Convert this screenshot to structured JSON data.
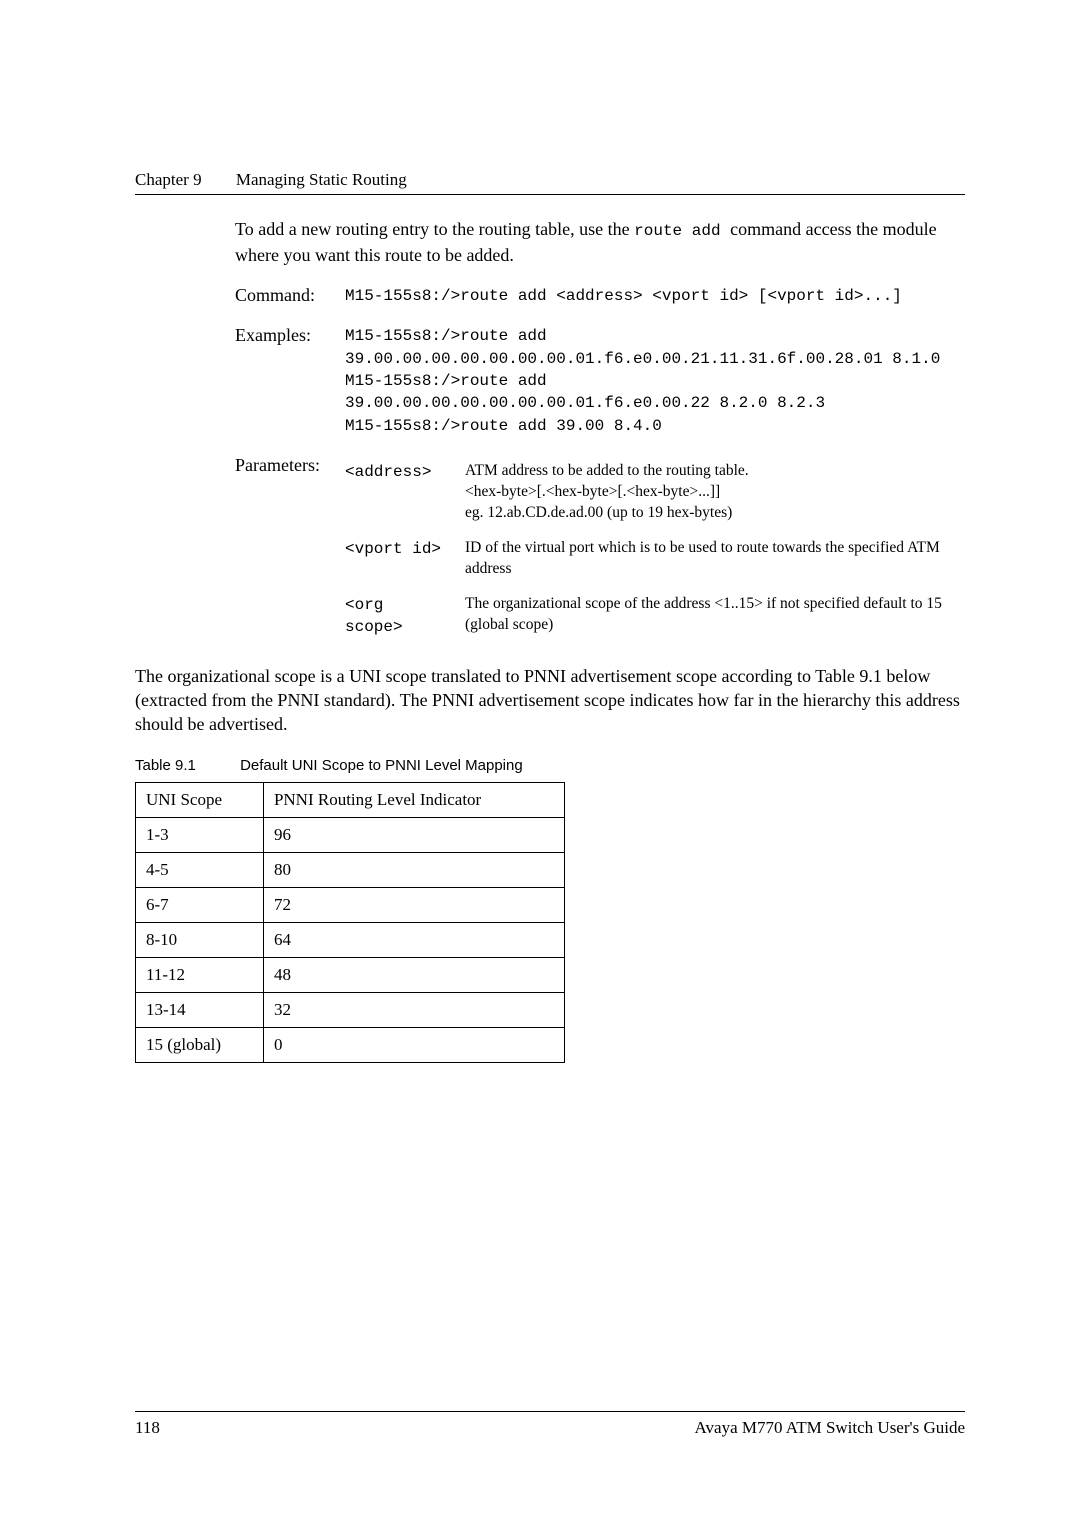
{
  "header": {
    "chapter_label": "Chapter 9",
    "chapter_title": "Managing Static Routing"
  },
  "intro": {
    "text_a": "To add a new routing entry to the routing table, use the ",
    "code": " route add ",
    "text_b": " command access the module where you want this route to be added."
  },
  "command": {
    "label": "Command:",
    "text": "M15-155s8:/>route add <address> <vport id> [<vport id>...]"
  },
  "examples": {
    "label": "Examples:",
    "lines": [
      "M15-155s8:/>route add",
      "39.00.00.00.00.00.00.00.01.f6.e0.00.21.11.31.6f.00.28.01  8.1.0",
      "M15-155s8:/>route add",
      "39.00.00.00.00.00.00.00.01.f6.e0.00.22  8.2.0 8.2.3",
      "M15-155s8:/>route add 39.00  8.4.0"
    ]
  },
  "parameters": {
    "label": "Parameters:",
    "rows": [
      {
        "name": "<address>",
        "desc": [
          "ATM address to be added to the routing table.",
          "<hex-byte>[.<hex-byte>[.<hex-byte>...]]",
          "eg. 12.ab.CD.de.ad.00 (up to 19 hex-bytes)"
        ]
      },
      {
        "name": "<vport id>",
        "desc": [
          "ID of the virtual port which is to be used to route towards the specified ATM address"
        ]
      },
      {
        "name_lines": [
          "<org",
          "scope>"
        ],
        "desc": [
          " The organizational scope of the address <1..15> if not specified default to 15 (global scope)"
        ]
      }
    ]
  },
  "para": "The organizational scope is a UNI scope translated to PNNI advertisement scope according to Table 9.1 below (extracted from the PNNI standard). The PNNI advertisement scope indicates how far in the hierarchy this address should be advertised.",
  "table": {
    "caption_label": "Table 9.1",
    "caption_title": "Default UNI Scope to PNNI Level Mapping",
    "headers": [
      "UNI Scope",
      "PNNI Routing Level Indicator"
    ],
    "rows": [
      [
        "1-3",
        "96"
      ],
      [
        "4-5",
        "80"
      ],
      [
        "6-7",
        "72"
      ],
      [
        "8-10",
        "64"
      ],
      [
        "11-12",
        "48"
      ],
      [
        "13-14",
        "32"
      ],
      [
        "15 (global)",
        "0"
      ]
    ]
  },
  "footer": {
    "page": "118",
    "doc": "Avaya M770 ATM Switch User's Guide"
  }
}
